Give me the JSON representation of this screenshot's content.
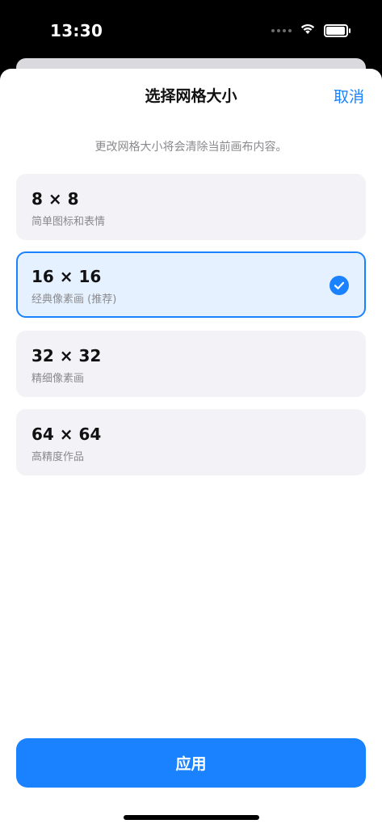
{
  "status_bar": {
    "time": "13:30",
    "battery_level": 0.95,
    "icons": [
      "signal-dots-icon",
      "wifi-icon",
      "battery-icon"
    ]
  },
  "sheet": {
    "title": "选择网格大小",
    "cancel_label": "取消",
    "subtitle": "更改网格大小将会清除当前画布内容。"
  },
  "options": [
    {
      "size": "8 × 8",
      "description": "简单图标和表情",
      "selected": false
    },
    {
      "size": "16 × 16",
      "description": "经典像素画 (推荐)",
      "selected": true
    },
    {
      "size": "32 × 32",
      "description": "精细像素画",
      "selected": false
    },
    {
      "size": "64 × 64",
      "description": "高精度作品",
      "selected": false
    }
  ],
  "apply_label": "应用",
  "colors": {
    "accent": "#1a82ff",
    "selected_bg": "#e6f1ff",
    "option_bg": "#f2f2f7",
    "secondary_text": "#8a8a8e"
  }
}
